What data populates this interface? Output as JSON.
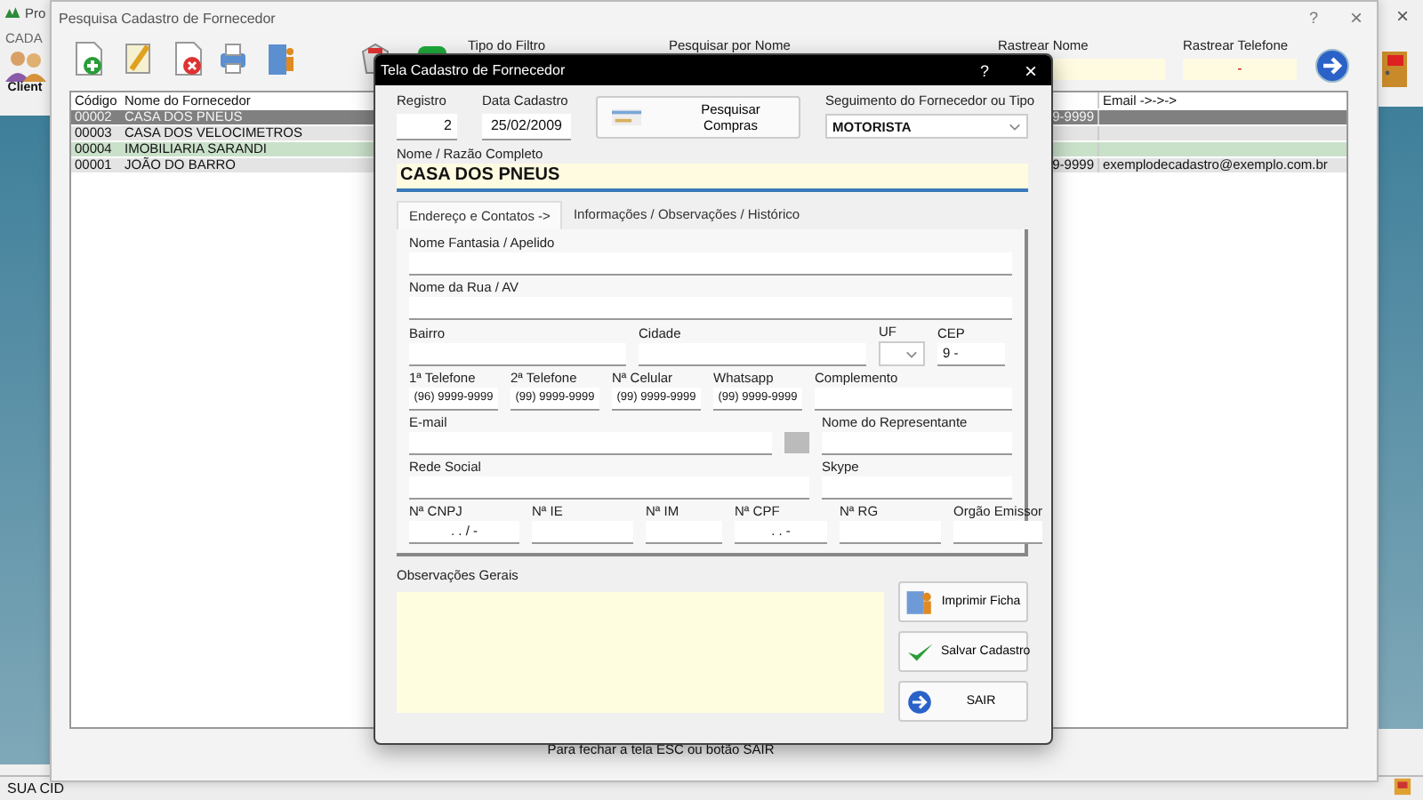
{
  "app": {
    "title": "Pro",
    "close_button": "×",
    "menu": "CADA",
    "toolbar_label": "Client",
    "status": "SUA CID"
  },
  "search_window": {
    "title": "Pesquisa Cadastro de Fornecedor",
    "help_button": "?",
    "close_button": "×",
    "filter_label": "Tipo do Filtro",
    "search_label": "Pesquisar por Nome",
    "track_name": {
      "label": "Rastrear Nome"
    },
    "track_phone": {
      "label": "Rastrear Telefone",
      "value": "-"
    },
    "table": {
      "columns": [
        "Código",
        "Nome do Fornecedor",
        "Email ->->->"
      ],
      "rows": [
        {
          "code": "00002",
          "name": "CASA DOS PNEUS",
          "phone": "9-9999",
          "selected": true
        },
        {
          "code": "00003",
          "name": "CASA DOS VELOCIMETROS",
          "selected": false,
          "color": "#e4e4e4"
        },
        {
          "code": "00004",
          "name": "IMOBILIARIA SARANDI",
          "selected": false,
          "color": "#c9e0c9"
        },
        {
          "code": "00001",
          "name": "JOÃO DO BARRO",
          "phone": "9-9999",
          "email": "exemplodecadastro@exemplo.com.br",
          "selected": false,
          "color": "#e4e4e4"
        }
      ]
    },
    "footer": "Para fechar a tela ESC ou botão SAIR"
  },
  "dialog": {
    "title": "Tela Cadastro de Fornecedor",
    "help_button": "?",
    "close_button": "×",
    "registro": {
      "label": "Registro",
      "value": "2"
    },
    "data_cadastro": {
      "label": "Data Cadastro",
      "value": "25/02/2009"
    },
    "search_purchases_button": "Pesquisar Compras",
    "segment": {
      "label": "Seguimento do Fornecedor ou Tipo",
      "value": "MOTORISTA"
    },
    "full_name": {
      "label": "Nome / Razão Completo",
      "value": "CASA DOS PNEUS"
    },
    "tabs": [
      {
        "label": "Endereço e Contatos ->",
        "selected": true
      },
      {
        "label": "Informações / Observações / Histórico",
        "selected": false
      }
    ],
    "rows": [
      {
        "fields": [
          {
            "kind": "text",
            "label": "Nome Fantasia / Apelido"
          }
        ]
      },
      {
        "fields": [
          {
            "kind": "text",
            "label": "Nome da Rua / AV"
          }
        ]
      },
      {
        "fields": [
          {
            "kind": "text",
            "label": "Bairro"
          },
          {
            "kind": "text",
            "label": "Cidade"
          },
          {
            "kind": "select",
            "label": "UF"
          },
          {
            "kind": "text",
            "label": "CEP",
            "value": "9 -"
          }
        ]
      },
      {
        "fields": [
          {
            "kind": "text",
            "label": "1ª Telefone",
            "value": "(96) 9999-9999"
          },
          {
            "kind": "text",
            "label": "2ª Telefone",
            "value": "(99) 9999-9999"
          },
          {
            "kind": "text",
            "label": "Nª Celular",
            "value": "(99) 9999-9999"
          },
          {
            "kind": "text",
            "label": "Whatsapp",
            "value": "(99) 9999-9999"
          },
          {
            "kind": "text",
            "label": "Complemento"
          }
        ]
      },
      {
        "fields": [
          {
            "kind": "text",
            "label": "E-mail"
          },
          {
            "kind": "button"
          },
          {
            "kind": "text",
            "label": "Nome do Representante"
          }
        ]
      },
      {
        "fields": [
          {
            "kind": "text",
            "label": "Rede Social"
          },
          {
            "kind": "text",
            "label": "Skype"
          }
        ]
      },
      {
        "fields": [
          {
            "kind": "text",
            "label": "Nª CNPJ",
            "value": ". . / -"
          },
          {
            "kind": "text",
            "label": "Nª IE"
          },
          {
            "kind": "text",
            "label": "Nª IM"
          },
          {
            "kind": "text",
            "label": "Nª CPF",
            "value": ". . -"
          },
          {
            "kind": "text",
            "label": "Nª RG"
          },
          {
            "kind": "text",
            "label": "Orgão Emissor"
          }
        ]
      }
    ],
    "notes": {
      "label": "Observações Gerais"
    },
    "buttons": [
      {
        "kind": "print",
        "label": "Imprimir Ficha"
      },
      {
        "kind": "save",
        "label": "Salvar Cadastro"
      },
      {
        "kind": "exit",
        "label": "SAIR"
      }
    ]
  }
}
